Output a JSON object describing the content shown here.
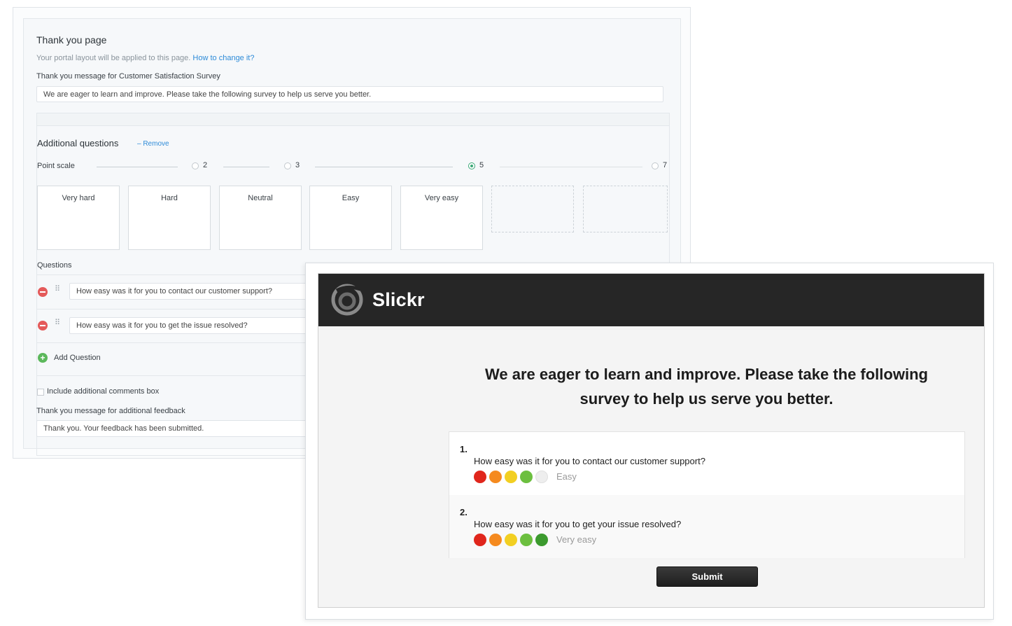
{
  "settings": {
    "title": "Thank you page",
    "hint_text": "Your portal layout will be applied to this page.",
    "hint_link": "How to change it?",
    "message_label": "Thank you message for Customer Satisfaction Survey",
    "message_value": "We are eager to learn and improve. Please take the following survey to help us serve you better.",
    "additional_title": "Additional questions",
    "remove_link": "– Remove",
    "point_scale_label": "Point scale",
    "scale_options": [
      "2",
      "3",
      "5",
      "7"
    ],
    "selected_scale": "5",
    "scale_cards": [
      "Very hard",
      "Hard",
      "Neutral",
      "Easy",
      "Very easy"
    ],
    "questions_label": "Questions",
    "questions": [
      "How easy was it for you to contact our customer support?",
      "How easy was it for you to get the issue resolved?"
    ],
    "add_question": "Add Question",
    "include_comments": "Include additional comments box",
    "feedback_label": "Thank you message for additional feedback",
    "feedback_value": "Thank you. Your feedback has been submitted."
  },
  "preview": {
    "brand": "Slickr",
    "headline_line1": "We are eager to learn and improve. Please take the following",
    "headline_line2": "survey to help us serve you better.",
    "questions": [
      {
        "number": "1.",
        "text": "How easy was it for you to contact our customer support?",
        "rating": 4,
        "rating_label": "Easy"
      },
      {
        "number": "2.",
        "text": "How easy was it for you to get your issue resolved?",
        "rating": 5,
        "rating_label": "Very easy"
      }
    ],
    "rating_colors": [
      "#e0261c",
      "#f58a1f",
      "#f2cf22",
      "#6cbf3f",
      "#3c9a2e"
    ],
    "empty_color": "#eeeeee",
    "submit": "Submit"
  },
  "colors": {
    "accent": "#2e8bd8",
    "radio_selected": "#3aa876",
    "remove": "#e45a5a",
    "add": "#5cb85c"
  }
}
